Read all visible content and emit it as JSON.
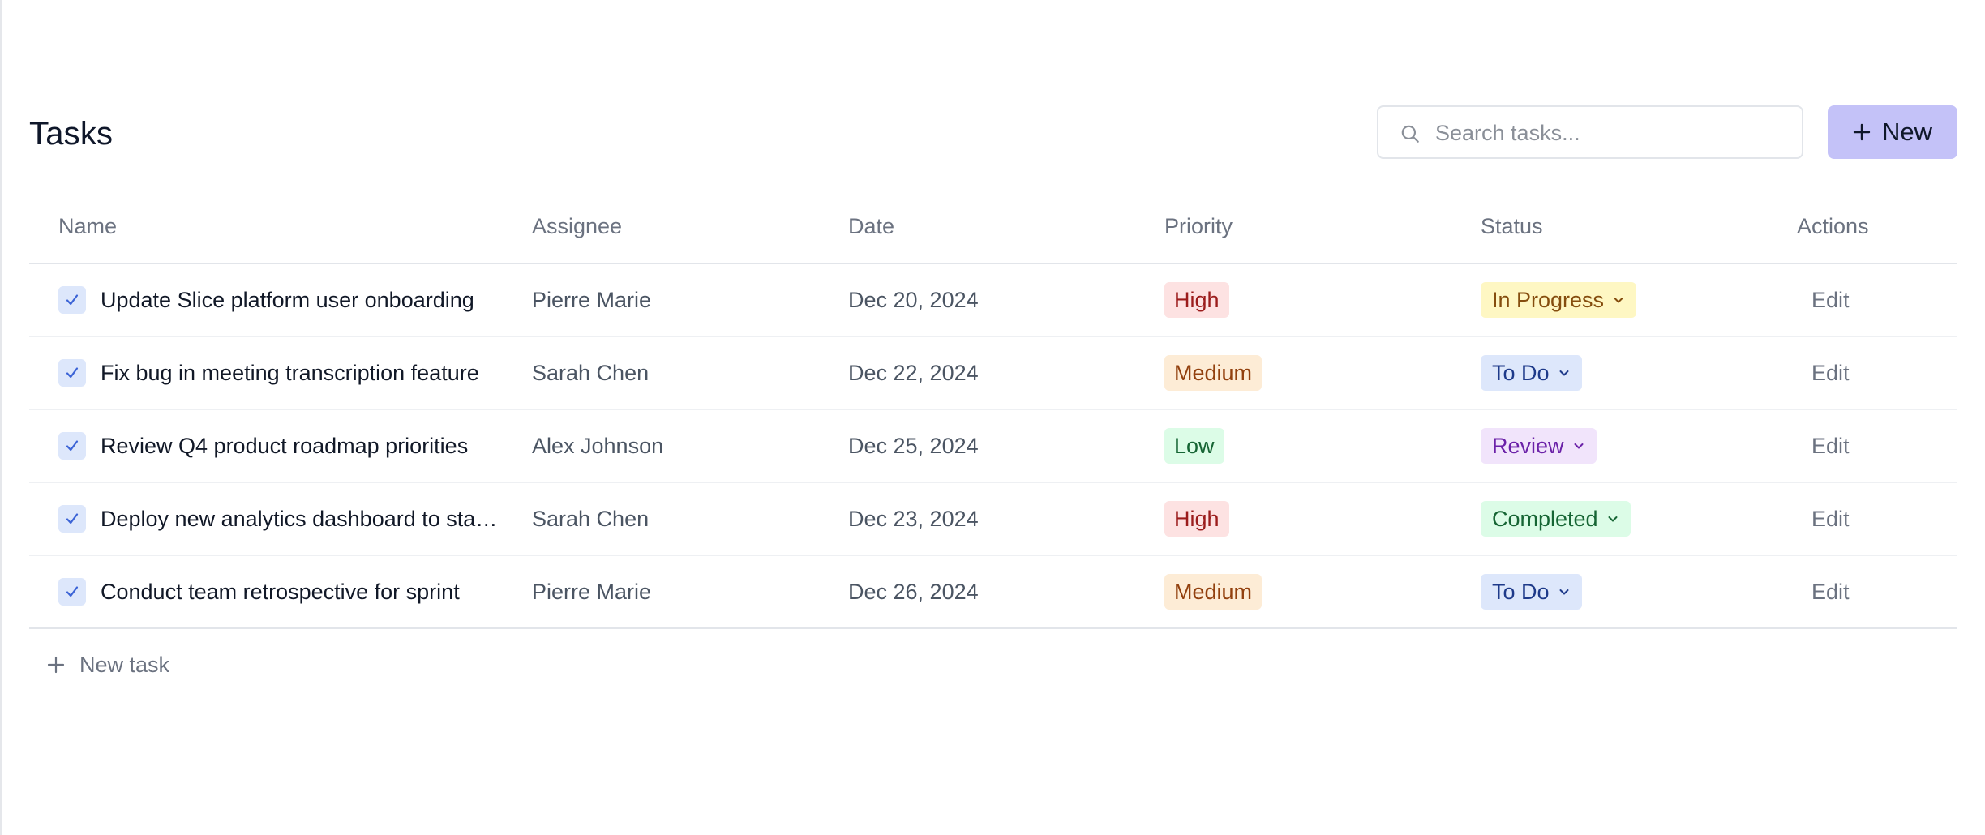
{
  "header": {
    "title": "Tasks",
    "search_placeholder": "Search tasks...",
    "new_label": "New"
  },
  "columns": [
    "Name",
    "Assignee",
    "Date",
    "Priority",
    "Status",
    "Actions"
  ],
  "tasks": [
    {
      "name": "Update Slice platform user onboarding",
      "assignee": "Pierre Marie",
      "date": "Dec 20, 2024",
      "priority": "High",
      "status": "In Progress",
      "action": "Edit"
    },
    {
      "name": "Fix bug in meeting transcription feature",
      "assignee": "Sarah Chen",
      "date": "Dec 22, 2024",
      "priority": "Medium",
      "status": "To Do",
      "action": "Edit"
    },
    {
      "name": "Review Q4 product roadmap priorities",
      "assignee": "Alex Johnson",
      "date": "Dec 25, 2024",
      "priority": "Low",
      "status": "Review",
      "action": "Edit"
    },
    {
      "name": "Deploy new analytics dashboard to staging",
      "assignee": "Sarah Chen",
      "date": "Dec 23, 2024",
      "priority": "High",
      "status": "Completed",
      "action": "Edit"
    },
    {
      "name": "Conduct team retrospective for sprint",
      "assignee": "Pierre Marie",
      "date": "Dec 26, 2024",
      "priority": "Medium",
      "status": "To Do",
      "action": "Edit"
    }
  ],
  "footer": {
    "new_task_label": "New task"
  },
  "colors": {
    "accent": "#c4c2f8",
    "priority": {
      "High": {
        "bg": "#fde2e2",
        "fg": "#9b1c1c"
      },
      "Medium": {
        "bg": "#fdecd6",
        "fg": "#92400e"
      },
      "Low": {
        "bg": "#dcfce7",
        "fg": "#166534"
      }
    },
    "status": {
      "In Progress": {
        "bg": "#fef7c3",
        "fg": "#854d0e"
      },
      "To Do": {
        "bg": "#dde7fb",
        "fg": "#1e3a8a"
      },
      "Review": {
        "bg": "#f1e4fb",
        "fg": "#6b21a8"
      },
      "Completed": {
        "bg": "#dcfce7",
        "fg": "#166534"
      }
    }
  },
  "icons": {
    "search": "search-icon",
    "plus": "plus-icon",
    "check": "checkbox-icon",
    "chevron": "chevron-down-icon"
  }
}
